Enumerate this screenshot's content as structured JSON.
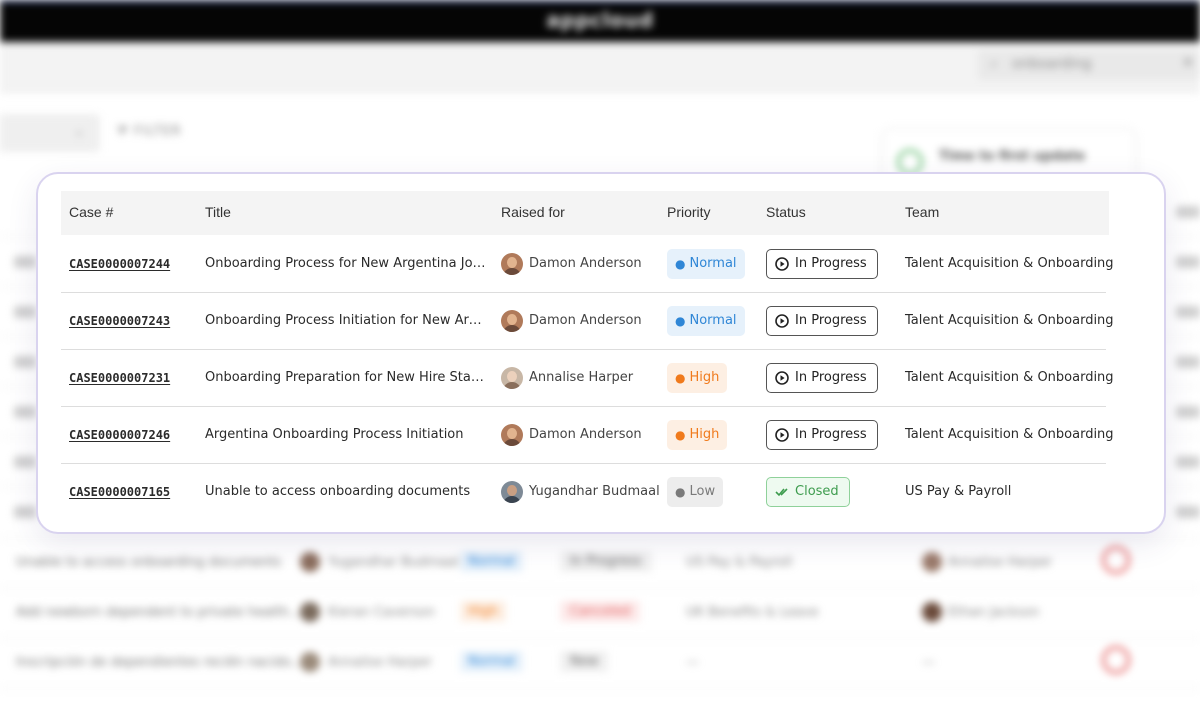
{
  "app": {
    "brand": "appcloud"
  },
  "background": {
    "search_value": "onboarding",
    "filter_label": "FILTER",
    "card_title": "Time to first update",
    "rows": [
      {
        "title": "Unable to access onboarding documents",
        "person": "Yugandhar Budmaal",
        "priority": "Normal",
        "status": "In Progress",
        "team": "US Pay & Payroll",
        "assignee": "Annalise Harper"
      },
      {
        "title": "Add newborn dependent to private health...",
        "person": "Kieran Caverson",
        "priority": "High",
        "status": "Canceled",
        "team": "UK Benefits & Leave",
        "assignee": "Ethan Jackson"
      },
      {
        "title": "Inscripción de dependientes recién nacido...",
        "person": "Annalise Harper",
        "priority": "Normal",
        "status": "New",
        "team": "—",
        "assignee": "—"
      }
    ]
  },
  "table": {
    "columns": {
      "case": "Case #",
      "title": "Title",
      "raised_for": "Raised for",
      "priority": "Priority",
      "status": "Status",
      "team": "Team"
    },
    "rows": [
      {
        "case": "CASE0000007244",
        "title": "Onboarding Process for New Argentina Joi…",
        "raised_for": "Damon Anderson",
        "priority": "Normal",
        "status": "In Progress",
        "team": "Talent Acquisition & Onboarding"
      },
      {
        "case": "CASE0000007243",
        "title": "Onboarding Process Initiation for New Arge…",
        "raised_for": "Damon Anderson",
        "priority": "Normal",
        "status": "In Progress",
        "team": "Talent Acquisition & Onboarding"
      },
      {
        "case": "CASE0000007231",
        "title": "Onboarding Preparation for New Hire Start …",
        "raised_for": "Annalise Harper",
        "priority": "High",
        "status": "In Progress",
        "team": "Talent Acquisition & Onboarding"
      },
      {
        "case": "CASE0000007246",
        "title": "Argentina Onboarding Process Initiation",
        "raised_for": "Damon Anderson",
        "priority": "High",
        "status": "In Progress",
        "team": "Talent Acquisition & Onboarding"
      },
      {
        "case": "CASE0000007165",
        "title": "Unable to access onboarding documents",
        "raised_for": "Yugandhar Budmaal",
        "priority": "Low",
        "status": "Closed",
        "team": "US Pay & Payroll"
      }
    ]
  },
  "colors": {
    "normal_bg": "#e6f1fb",
    "normal_fg": "#2f86d6",
    "high_bg": "#fdefe3",
    "high_fg": "#f07a1c",
    "low_bg": "#ededed",
    "low_fg": "#7a7a7a",
    "closed_fg": "#3d9c4e",
    "card_border": "#d9d3ef"
  }
}
